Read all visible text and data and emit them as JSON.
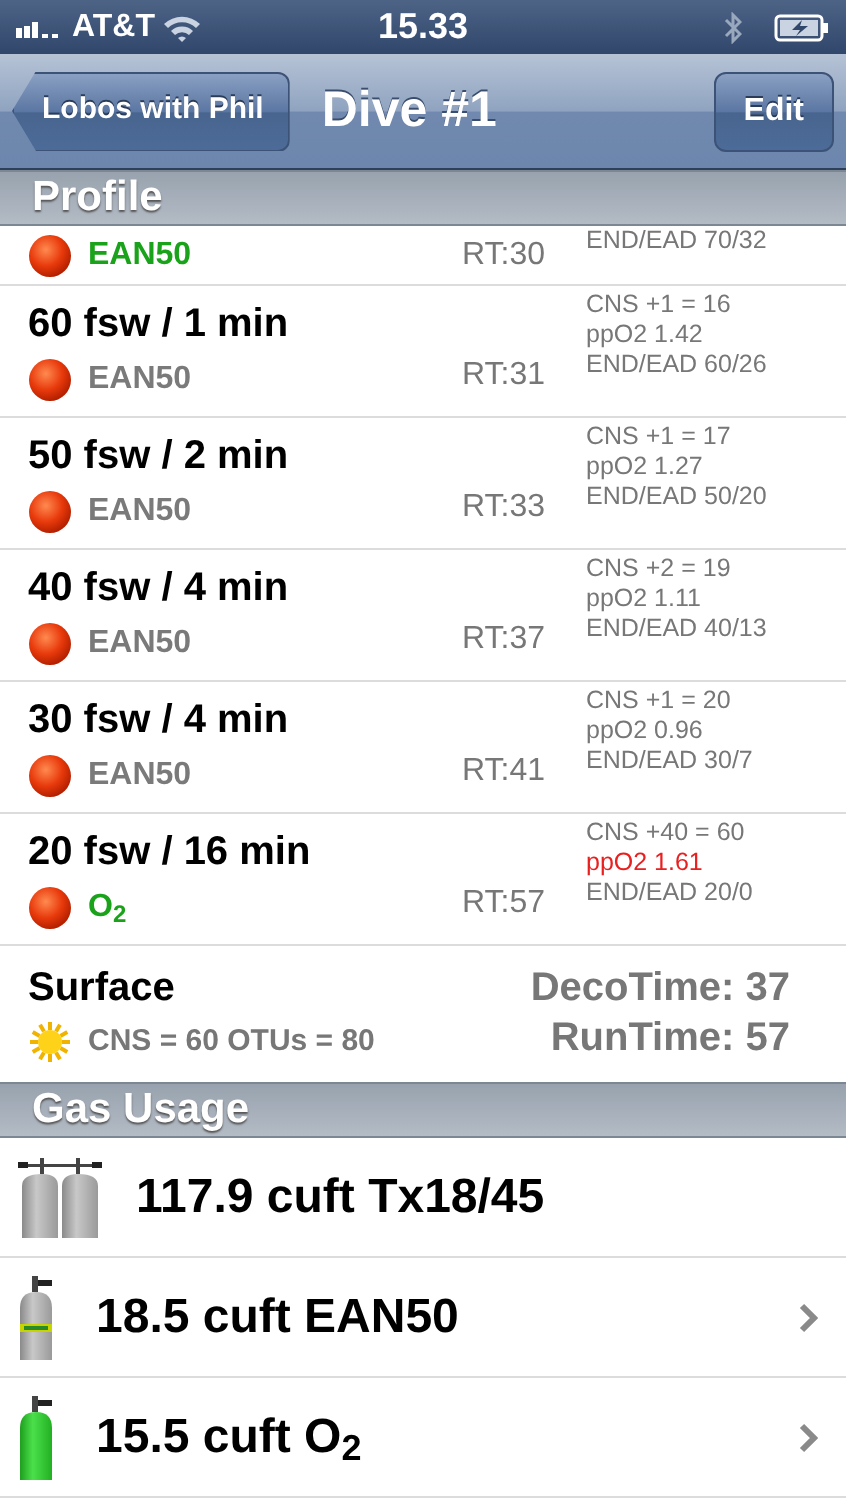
{
  "status_bar": {
    "carrier": "AT&T",
    "time": "15.33"
  },
  "nav_bar": {
    "back": "Lobos with Phil",
    "title": "Dive #1",
    "action": "Edit"
  },
  "profile": {
    "header": "Profile",
    "stops": [
      {
        "gas": {
          "text": "EAN50",
          "color": "#1aa31a"
        },
        "runtime": "RT:30",
        "info": [
          {
            "text": "END/EAD 70/32",
            "warning": false
          }
        ]
      },
      {
        "title": "60 fsw / 1 min",
        "gas": {
          "text": "EAN50",
          "color": "#7a7a7a"
        },
        "runtime": "RT:31",
        "info": [
          {
            "text": "CNS +1 = 16",
            "warning": false
          },
          {
            "text": "ppO2 1.42",
            "warning": false
          },
          {
            "text": "END/EAD 60/26",
            "warning": false
          }
        ]
      },
      {
        "title": "50 fsw / 2 min",
        "gas": {
          "text": "EAN50",
          "color": "#7a7a7a"
        },
        "runtime": "RT:33",
        "info": [
          {
            "text": "CNS +1 = 17",
            "warning": false
          },
          {
            "text": "ppO2 1.27",
            "warning": false
          },
          {
            "text": "END/EAD 50/20",
            "warning": false
          }
        ]
      },
      {
        "title": "40 fsw / 4 min",
        "gas": {
          "text": "EAN50",
          "color": "#7a7a7a"
        },
        "runtime": "RT:37",
        "info": [
          {
            "text": "CNS +2 = 19",
            "warning": false
          },
          {
            "text": "ppO2 1.11",
            "warning": false
          },
          {
            "text": "END/EAD 40/13",
            "warning": false
          }
        ]
      },
      {
        "title": "30 fsw / 4 min",
        "gas": {
          "text": "EAN50",
          "color": "#7a7a7a"
        },
        "runtime": "RT:41",
        "info": [
          {
            "text": "CNS +1 = 20",
            "warning": false
          },
          {
            "text": "ppO2 0.96",
            "warning": false
          },
          {
            "text": "END/EAD 30/7",
            "warning": false
          }
        ]
      },
      {
        "title": "20 fsw / 16 min",
        "gas": {
          "text": "O$_{2}$",
          "color": "#1aa31a"
        },
        "runtime": "RT:57",
        "info": [
          {
            "text": "CNS +40 = 60",
            "warning": false
          },
          {
            "text": "ppO2 1.61",
            "warning": true
          },
          {
            "text": "END/EAD 20/0",
            "warning": false
          }
        ]
      }
    ],
    "surface": {
      "title": "Surface",
      "summary": "CNS = 60 OTUs = 80",
      "deco_time": "DecoTime: 37",
      "run_time": "RunTime: 57"
    }
  },
  "gas_usage": {
    "header": "Gas Usage",
    "rows": [
      {
        "kind": "twin",
        "text": "117.9 cuft Tx18/45",
        "disclosure": false
      },
      {
        "kind": "nitrox",
        "text": "18.5 cuft EAN50",
        "disclosure": true
      },
      {
        "kind": "oxygen",
        "text": "15.5 cuft O$_{2}$",
        "disclosure": true
      }
    ]
  }
}
